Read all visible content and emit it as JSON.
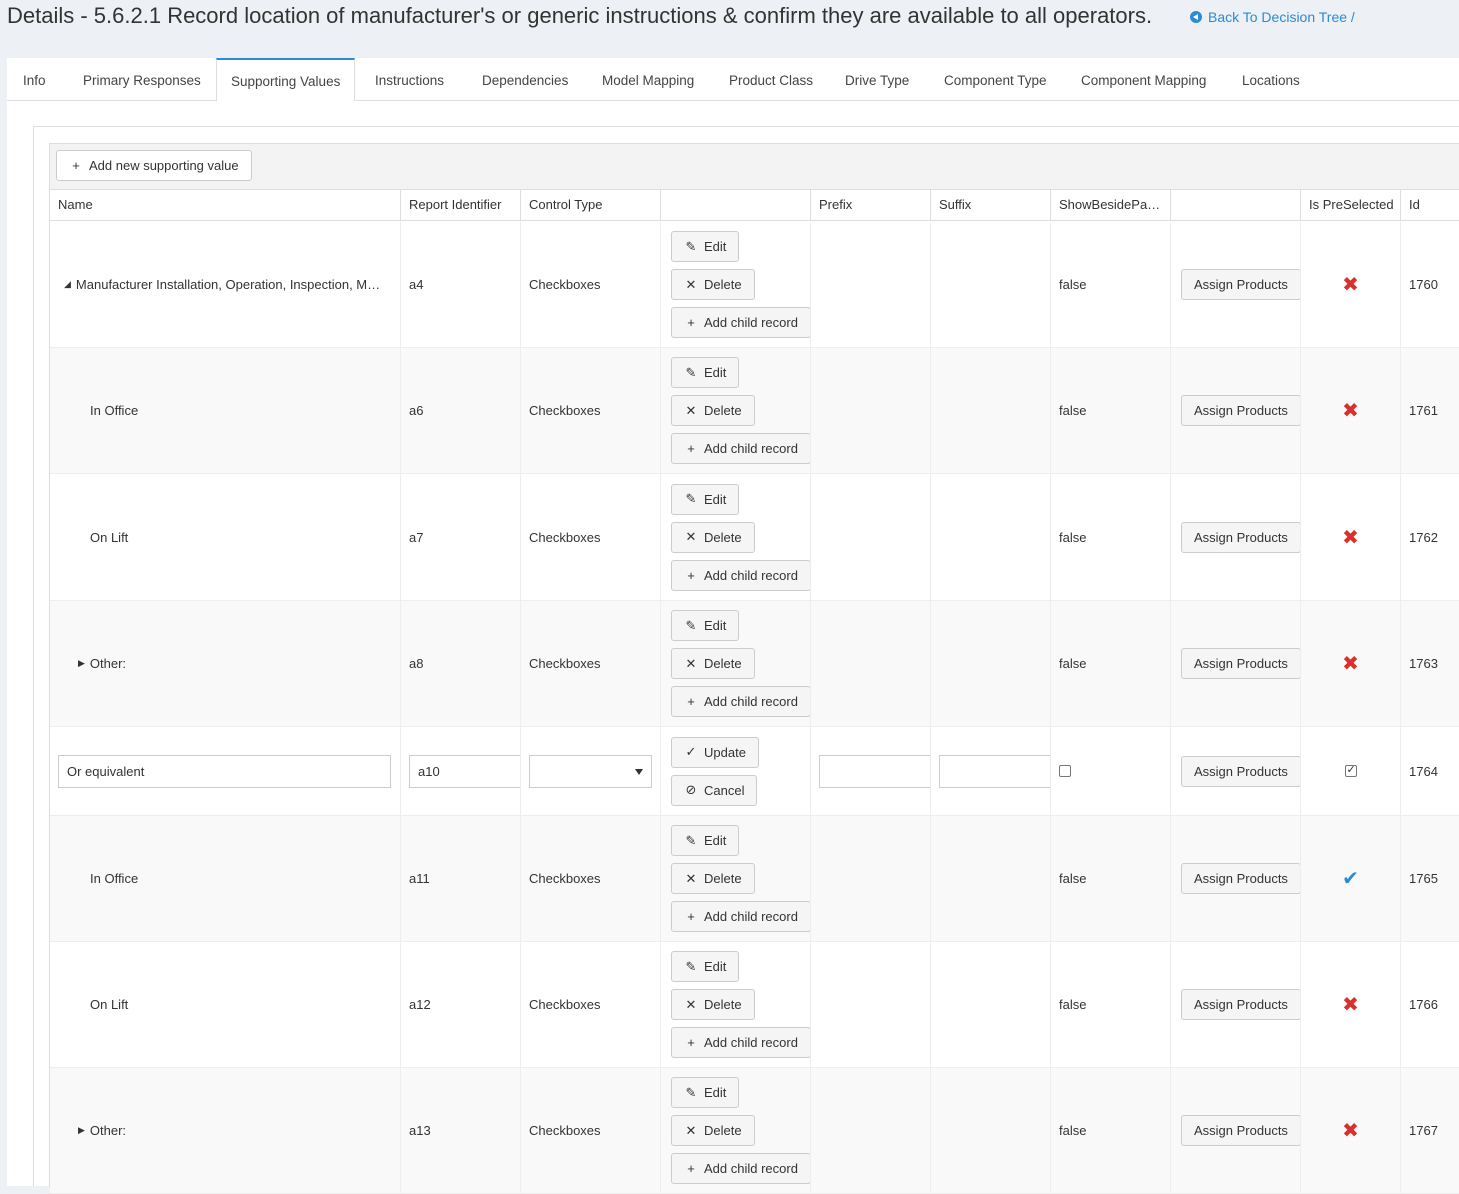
{
  "header": {
    "title": "Details - 5.6.2.1 Record location of manufacturer's or generic instructions & confirm they are available to all operators.",
    "back_link": "Back To Decision Tree /",
    "back_icon": "arrow-left-circle-icon"
  },
  "tabs": [
    {
      "label": "Info"
    },
    {
      "label": "Primary Responses"
    },
    {
      "label": "Supporting Values",
      "active": true
    },
    {
      "label": "Instructions"
    },
    {
      "label": "Dependencies"
    },
    {
      "label": "Model Mapping"
    },
    {
      "label": "Product Class"
    },
    {
      "label": "Drive Type"
    },
    {
      "label": "Component Type"
    },
    {
      "label": "Component Mapping"
    },
    {
      "label": "Locations"
    }
  ],
  "toolbar": {
    "add_label": "Add new supporting value"
  },
  "columns": [
    "Name",
    "Report Identifier",
    "Control Type",
    "",
    "Prefix",
    "Suffix",
    "ShowBesidePa…",
    "",
    "Is PreSelected",
    "Id"
  ],
  "commands": {
    "edit": "Edit",
    "delete": "Delete",
    "add_child": "Add child record",
    "update": "Update",
    "cancel": "Cancel",
    "assign": "Assign Products"
  },
  "rows": [
    {
      "name": "Manufacturer Installation, Operation, Inspection, M…",
      "report_id": "a4",
      "control_type": "Checkboxes",
      "show_beside": "false",
      "preselected": false,
      "id": "1760"
    },
    {
      "name": "In Office",
      "report_id": "a6",
      "control_type": "Checkboxes",
      "show_beside": "false",
      "preselected": false,
      "id": "1761"
    },
    {
      "name": "On Lift",
      "report_id": "a7",
      "control_type": "Checkboxes",
      "show_beside": "false",
      "preselected": false,
      "id": "1762"
    },
    {
      "name": "Other:",
      "report_id": "a8",
      "control_type": "Checkboxes",
      "show_beside": "false",
      "preselected": false,
      "id": "1763"
    },
    {
      "name": "Or equivalent",
      "report_id": "a10",
      "control_type": "",
      "show_beside": "",
      "preselected": true,
      "id": "1764"
    },
    {
      "name": "In Office",
      "report_id": "a11",
      "control_type": "Checkboxes",
      "show_beside": "false",
      "preselected": true,
      "id": "1765"
    },
    {
      "name": "On Lift",
      "report_id": "a12",
      "control_type": "Checkboxes",
      "show_beside": "false",
      "preselected": false,
      "id": "1766"
    },
    {
      "name": "Other:",
      "report_id": "a13",
      "control_type": "Checkboxes",
      "show_beside": "false",
      "preselected": false,
      "id": "1767"
    }
  ],
  "colors": {
    "accent": "#2b8bd4",
    "danger": "#d9302c"
  }
}
